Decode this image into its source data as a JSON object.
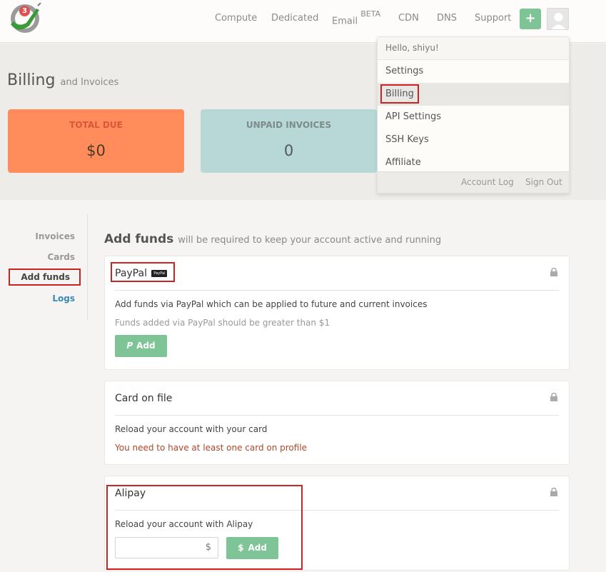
{
  "nav": {
    "badge": "3",
    "items": [
      "Compute",
      "Dedicated",
      "Email",
      "CDN",
      "DNS",
      "Support"
    ],
    "email_sup": "BETA",
    "plus": "+"
  },
  "header": {
    "title": "Billing",
    "subtitle": "and Invoices",
    "total_due_label": "TOTAL DUE",
    "total_due_value": "$0",
    "unpaid_label": "UNPAID INVOICES",
    "unpaid_value": "0"
  },
  "dropdown": {
    "greeting": "Hello, shiyu!",
    "items": [
      "Settings",
      "Billing",
      "API Settings",
      "SSH Keys",
      "Affiliate"
    ],
    "account_log": "Account Log",
    "sign_out": "Sign Out"
  },
  "side": {
    "items": [
      "Invoices",
      "Cards",
      "Add funds",
      "Logs"
    ]
  },
  "main": {
    "title": "Add funds",
    "subtitle": "will be required to keep your account active and running",
    "paypal": {
      "title": "PayPal",
      "logo_text": "PayPal",
      "desc": "Add funds via PayPal which can be applied to future and current invoices",
      "note": "Funds added via PayPal should be greater than $1",
      "button": "Add"
    },
    "card": {
      "title": "Card on file",
      "desc": "Reload your account with your card",
      "warning": "You need to have at least one card on profile"
    },
    "alipay": {
      "title": "Alipay",
      "desc": "Reload your account with Alipay",
      "currency": "$",
      "button": "Add"
    }
  },
  "colors": {
    "accent_green": "#7ec496",
    "total_due_bg": "#ff8c5a",
    "unpaid_bg": "#b7d8d6",
    "link_blue": "#3a8ab7",
    "warning_red": "#b0462a",
    "annotation_red": "#cc2222"
  }
}
